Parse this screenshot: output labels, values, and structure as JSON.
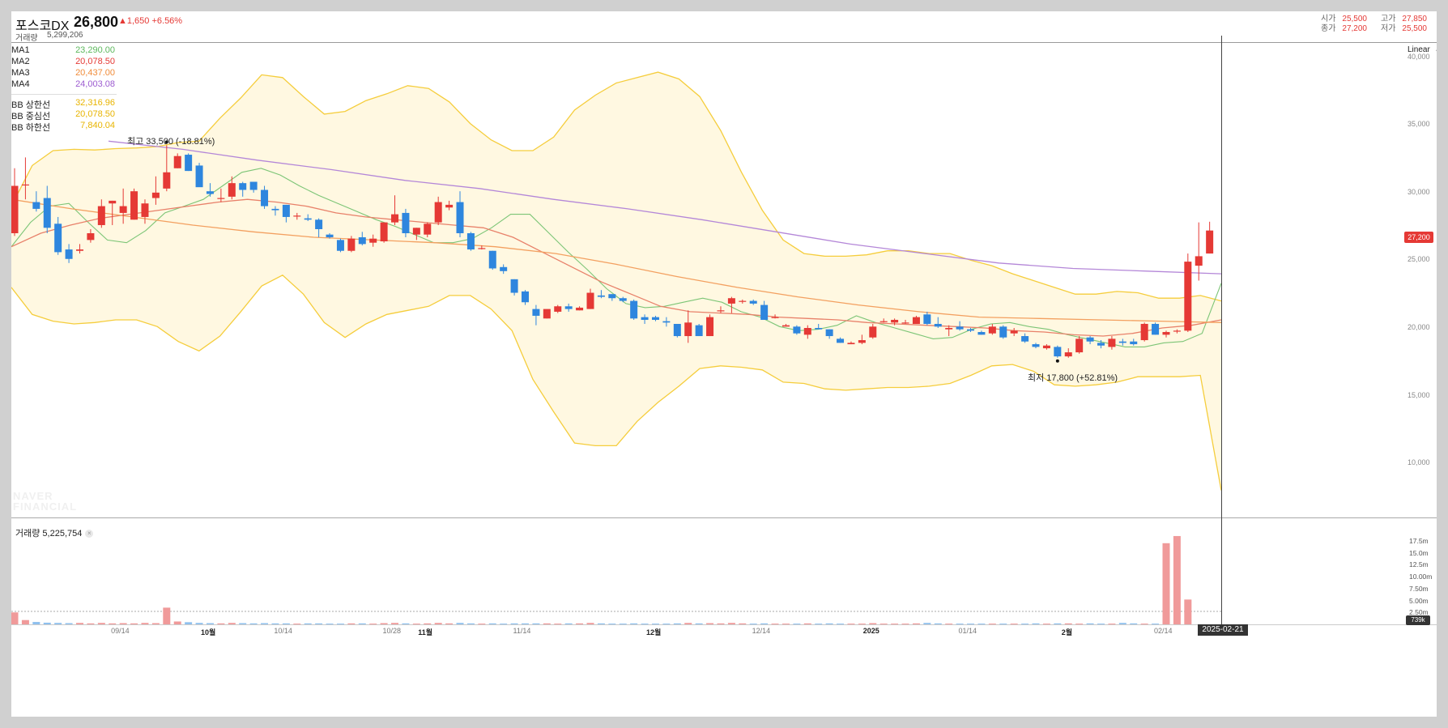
{
  "header": {
    "name": "포스코DX",
    "price": "26,800",
    "change": "▲1,650 +6.56%",
    "volume_label": "거래량",
    "volume": "5,299,206",
    "ohlc": {
      "open_label": "시가",
      "open": "25,500",
      "high_label": "고가",
      "high": "27,850",
      "close_label": "종가",
      "close": "27,200",
      "low_label": "저가",
      "low": "25,500"
    }
  },
  "legend": {
    "ma": [
      {
        "name": "MA1",
        "value": "23,290.00",
        "color": "#5cb85c"
      },
      {
        "name": "MA2",
        "value": "20,078.50",
        "color": "#e53935"
      },
      {
        "name": "MA3",
        "value": "20,437.00",
        "color": "#f08c3a"
      },
      {
        "name": "MA4",
        "value": "24,003.08",
        "color": "#9c5bd0"
      }
    ],
    "bb": [
      {
        "name": "BB 상한선",
        "value": "32,316.96",
        "color": "#e8b400"
      },
      {
        "name": "BB 중심선",
        "value": "20,078.50",
        "color": "#e8b400"
      },
      {
        "name": "BB 하한선",
        "value": "7,840.04",
        "color": "#e8b400"
      }
    ]
  },
  "annotations": {
    "high": "최고 33,500 (-18.81%)",
    "low": "최저 17,800 (+52.81%)"
  },
  "scale_button": "Linear",
  "watermark": [
    "NAVER",
    "FINANCIAL"
  ],
  "volume_panel": {
    "label": "거래량 5,225,754"
  },
  "current_price_tag": "27,200",
  "current_volume_tag": "739k",
  "cursor_date": "2025-02-21",
  "colors": {
    "up": "#e53935",
    "down": "#2e86de",
    "band_fill": "#fff8e1",
    "band_line": "#f5cd3c"
  },
  "chart_data": {
    "type": "candlestick",
    "y_axis": {
      "ticks": [
        "10,000",
        "15,000",
        "20,000",
        "25,000",
        "30,000",
        "35,000",
        "40,000"
      ],
      "range": [
        6000,
        41000
      ],
      "scale": "linear"
    },
    "volume_axis": {
      "ticks": [
        "2.50m",
        "5.00m",
        "7.50m",
        "10.00m",
        "12.5m",
        "15.0m",
        "17.5m"
      ]
    },
    "x_axis": {
      "labels": [
        "09/14",
        "10월",
        "10/14",
        "10/28",
        "11월",
        "11/14",
        "12월",
        "12/14",
        "2025",
        "01/14",
        "2월",
        "02/14"
      ]
    },
    "ohlc": [
      [
        27000,
        31800,
        26800,
        30500
      ],
      [
        30600,
        32600,
        29500,
        30600
      ],
      [
        29300,
        30100,
        28600,
        28800
      ],
      [
        29600,
        30500,
        27000,
        27400
      ],
      [
        27700,
        28200,
        25400,
        25600
      ],
      [
        25800,
        26200,
        24800,
        25100
      ],
      [
        25700,
        26200,
        25500,
        25800
      ],
      [
        26500,
        27300,
        26300,
        27000
      ],
      [
        27600,
        29500,
        27400,
        29000
      ],
      [
        29200,
        29400,
        27600,
        29400
      ],
      [
        28500,
        30300,
        27700,
        29000
      ],
      [
        28000,
        30300,
        28000,
        30100
      ],
      [
        28200,
        29500,
        27700,
        29200
      ],
      [
        29600,
        31200,
        29100,
        30000
      ],
      [
        30300,
        33500,
        30100,
        31500
      ],
      [
        31800,
        32900,
        31800,
        32700
      ],
      [
        32800,
        32900,
        31600,
        31600
      ],
      [
        32000,
        32200,
        30600,
        30400
      ],
      [
        30100,
        30700,
        29700,
        29900
      ],
      [
        29600,
        30300,
        29300,
        29600
      ],
      [
        29700,
        31200,
        29500,
        30700
      ],
      [
        30700,
        30800,
        29700,
        30200
      ],
      [
        30800,
        30800,
        30000,
        30200
      ],
      [
        30200,
        30500,
        28800,
        29000
      ],
      [
        28800,
        29000,
        28300,
        28700
      ],
      [
        29100,
        29100,
        27800,
        28200
      ],
      [
        28300,
        28500,
        28000,
        28300
      ],
      [
        28100,
        28400,
        27900,
        28000
      ],
      [
        28000,
        28100,
        26700,
        27300
      ],
      [
        26900,
        27000,
        26600,
        26700
      ],
      [
        26500,
        26600,
        25600,
        25700
      ],
      [
        25700,
        26800,
        25600,
        26600
      ],
      [
        26700,
        27100,
        26100,
        26200
      ],
      [
        26300,
        26900,
        26000,
        26600
      ],
      [
        26400,
        27800,
        26300,
        27800
      ],
      [
        27800,
        29800,
        27600,
        28400
      ],
      [
        28500,
        28800,
        26700,
        27000
      ],
      [
        26900,
        27400,
        26500,
        27400
      ],
      [
        26900,
        27800,
        26700,
        27700
      ],
      [
        27800,
        29700,
        27600,
        29300
      ],
      [
        28900,
        29400,
        28700,
        29100
      ],
      [
        29300,
        30100,
        26700,
        27000
      ],
      [
        27000,
        27100,
        25700,
        25800
      ],
      [
        25900,
        26100,
        25800,
        25900
      ],
      [
        25700,
        25700,
        24300,
        24400
      ],
      [
        24500,
        24700,
        24000,
        24200
      ],
      [
        23600,
        23600,
        22400,
        22600
      ],
      [
        22700,
        22800,
        21700,
        21900
      ],
      [
        21400,
        21700,
        20200,
        20900
      ],
      [
        20700,
        21300,
        20700,
        21400
      ],
      [
        21200,
        21700,
        21100,
        21600
      ],
      [
        21600,
        21800,
        21200,
        21400
      ],
      [
        21300,
        21600,
        21300,
        21500
      ],
      [
        21400,
        22900,
        21400,
        22600
      ],
      [
        22400,
        22800,
        22200,
        22300
      ],
      [
        22500,
        22500,
        22000,
        22200
      ],
      [
        22200,
        22300,
        21900,
        22000
      ],
      [
        22000,
        22100,
        20600,
        20700
      ],
      [
        20800,
        21000,
        20300,
        20600
      ],
      [
        20800,
        20900,
        20500,
        20600
      ],
      [
        20500,
        20800,
        20100,
        20400
      ],
      [
        20300,
        20300,
        19300,
        19400
      ],
      [
        19400,
        21300,
        18900,
        20400
      ],
      [
        20200,
        20300,
        19400,
        19400
      ],
      [
        19400,
        21000,
        19400,
        20800
      ],
      [
        21300,
        21600,
        21100,
        21300
      ],
      [
        21800,
        22300,
        21100,
        22200
      ],
      [
        22000,
        22100,
        21800,
        22000
      ],
      [
        22000,
        22100,
        21700,
        21800
      ],
      [
        21700,
        22000,
        20600,
        20600
      ],
      [
        20800,
        21000,
        20700,
        20800
      ],
      [
        20100,
        20300,
        20100,
        20200
      ],
      [
        20100,
        20200,
        19500,
        19600
      ],
      [
        19500,
        20200,
        19200,
        20000
      ],
      [
        20000,
        20300,
        19900,
        19900
      ],
      [
        19900,
        19900,
        19200,
        19400
      ],
      [
        19200,
        19300,
        18900,
        18900
      ],
      [
        18800,
        19000,
        18800,
        18900
      ],
      [
        18900,
        19500,
        18800,
        19100
      ],
      [
        19300,
        20300,
        19200,
        20100
      ],
      [
        20500,
        20700,
        20400,
        20500
      ],
      [
        20400,
        20700,
        20200,
        20600
      ],
      [
        20400,
        20600,
        20300,
        20400
      ],
      [
        20300,
        20900,
        20300,
        20800
      ],
      [
        21000,
        21200,
        20200,
        20300
      ],
      [
        20300,
        20800,
        20000,
        20100
      ],
      [
        19900,
        20200,
        19400,
        20000
      ],
      [
        20100,
        20500,
        19800,
        19900
      ],
      [
        19900,
        20000,
        19700,
        19800
      ],
      [
        19700,
        19800,
        19500,
        19500
      ],
      [
        19600,
        20300,
        19500,
        20100
      ],
      [
        20100,
        20200,
        19200,
        19300
      ],
      [
        19600,
        20000,
        19400,
        19800
      ],
      [
        19400,
        19600,
        18900,
        19000
      ],
      [
        18800,
        18900,
        18500,
        18600
      ],
      [
        18500,
        18800,
        18400,
        18700
      ],
      [
        18600,
        18700,
        17800,
        17900
      ],
      [
        17900,
        18500,
        17800,
        18200
      ],
      [
        18200,
        19400,
        18100,
        19200
      ],
      [
        19300,
        19400,
        18800,
        19000
      ],
      [
        18900,
        19100,
        18500,
        18700
      ],
      [
        18600,
        19400,
        18400,
        19200
      ],
      [
        19000,
        19200,
        18700,
        18900
      ],
      [
        19000,
        19200,
        18700,
        18800
      ],
      [
        19100,
        20400,
        19000,
        20300
      ],
      [
        20300,
        20400,
        19500,
        19500
      ],
      [
        19500,
        19800,
        19300,
        19700
      ],
      [
        19800,
        19900,
        19600,
        19800
      ],
      [
        19800,
        25500,
        19700,
        24900
      ],
      [
        24600,
        27800,
        23500,
        25300
      ],
      [
        25500,
        27850,
        25500,
        27200
      ]
    ],
    "volumes_m": [
      2.5,
      0.9,
      0.5,
      0.35,
      0.3,
      0.25,
      0.3,
      0.2,
      0.3,
      0.2,
      0.25,
      0.2,
      0.3,
      0.25,
      3.5,
      0.6,
      0.45,
      0.3,
      0.25,
      0.2,
      0.3,
      0.25,
      0.2,
      0.25,
      0.2,
      0.2,
      0.15,
      0.2,
      0.2,
      0.15,
      0.15,
      0.2,
      0.2,
      0.15,
      0.25,
      0.3,
      0.2,
      0.15,
      0.2,
      0.3,
      0.2,
      0.3,
      0.2,
      0.15,
      0.2,
      0.15,
      0.2,
      0.2,
      0.2,
      0.2,
      0.15,
      0.2,
      0.2,
      0.3,
      0.2,
      0.15,
      0.15,
      0.2,
      0.15,
      0.15,
      0.15,
      0.2,
      0.3,
      0.2,
      0.25,
      0.2,
      0.3,
      0.2,
      0.15,
      0.2,
      0.15,
      0.15,
      0.15,
      0.2,
      0.15,
      0.2,
      0.15,
      0.15,
      0.15,
      0.25,
      0.15,
      0.15,
      0.15,
      0.2,
      0.3,
      0.2,
      0.15,
      0.15,
      0.15,
      0.15,
      0.15,
      0.15,
      0.15,
      0.15,
      0.2,
      0.15,
      0.2,
      0.2,
      0.15,
      0.2,
      0.15,
      0.15,
      0.3,
      0.2,
      0.15,
      0.15,
      17.0,
      18.5,
      5.2
    ],
    "band": {
      "upper": [
        29000,
        32000,
        33100,
        33200,
        33150,
        33250,
        33300,
        33400,
        33700,
        33800,
        35500,
        37000,
        38700,
        38500,
        37100,
        35800,
        36000,
        36800,
        37300,
        37900,
        37700,
        36700,
        35100,
        33900,
        33100,
        33100,
        34100,
        36100,
        37200,
        38100,
        38500,
        38900,
        38400,
        37100,
        34600,
        31500,
        28700,
        26500,
        25500,
        25300,
        25300,
        25400,
        25700,
        25700,
        25500,
        25500,
        25000,
        24600,
        24000,
        23500,
        23000,
        22500,
        22500,
        22700,
        22600,
        22200,
        22200,
        22400,
        22000
      ],
      "lower": [
        23000,
        21000,
        20500,
        20300,
        20400,
        20600,
        20600,
        20100,
        19000,
        18300,
        19400,
        21200,
        23100,
        23900,
        22500,
        20400,
        19300,
        20300,
        21000,
        21300,
        21600,
        22400,
        22400,
        21400,
        19800,
        16200,
        13800,
        11500,
        11300,
        11300,
        13100,
        14500,
        15700,
        17000,
        17200,
        17100,
        16900,
        16000,
        15900,
        15500,
        15400,
        15500,
        15600,
        15600,
        15700,
        15900,
        16500,
        17200,
        17300,
        16800,
        15800,
        15700,
        15800,
        16000,
        16400,
        16400,
        16400,
        16500,
        8000
      ]
    },
    "ma_lines": {
      "MA1": [
        26000,
        27800,
        29000,
        29200,
        27800,
        26500,
        26300,
        27200,
        28500,
        29000,
        29500,
        30500,
        31500,
        31800,
        31300,
        30500,
        29800,
        29200,
        28600,
        28000,
        27500,
        26900,
        26300,
        26300,
        26600,
        27400,
        28400,
        28400,
        27000,
        25600,
        24300,
        22900,
        21800,
        21500,
        21600,
        21900,
        22200,
        21900,
        21200,
        20800,
        20100,
        19800,
        19900,
        20200,
        20900,
        20400,
        20000,
        19600,
        19200,
        19300,
        19900,
        20300,
        20400,
        20100,
        19900,
        19500,
        19200,
        18900,
        18600,
        18600,
        18900,
        19000,
        19600,
        23300
      ],
      "MA2": [
        26000,
        27000,
        27600,
        28100,
        28400,
        28700,
        29000,
        29300,
        29500,
        29300,
        29000,
        28500,
        28200,
        28000,
        27800,
        27600,
        27400,
        26700,
        25600,
        24500,
        23400,
        22500,
        21600,
        21200,
        21100,
        21000,
        20800,
        20700,
        20600,
        20400,
        20300,
        20200,
        20100,
        20000,
        19800,
        19700,
        19500,
        19400,
        19600,
        20000,
        20200,
        20600
      ],
      "MA3": [
        29500,
        28800,
        28200,
        27600,
        27100,
        26700,
        26500,
        26300,
        26000,
        25500,
        24700,
        23800,
        23000,
        22300,
        21700,
        21200,
        20800,
        20700,
        20600,
        20500,
        20400
      ],
      "MA4": [
        33800,
        33200,
        32400,
        31700,
        30900,
        30300,
        29500,
        28800,
        28000,
        27100,
        26200,
        25500,
        24800,
        24400,
        24200,
        24000
      ]
    }
  }
}
